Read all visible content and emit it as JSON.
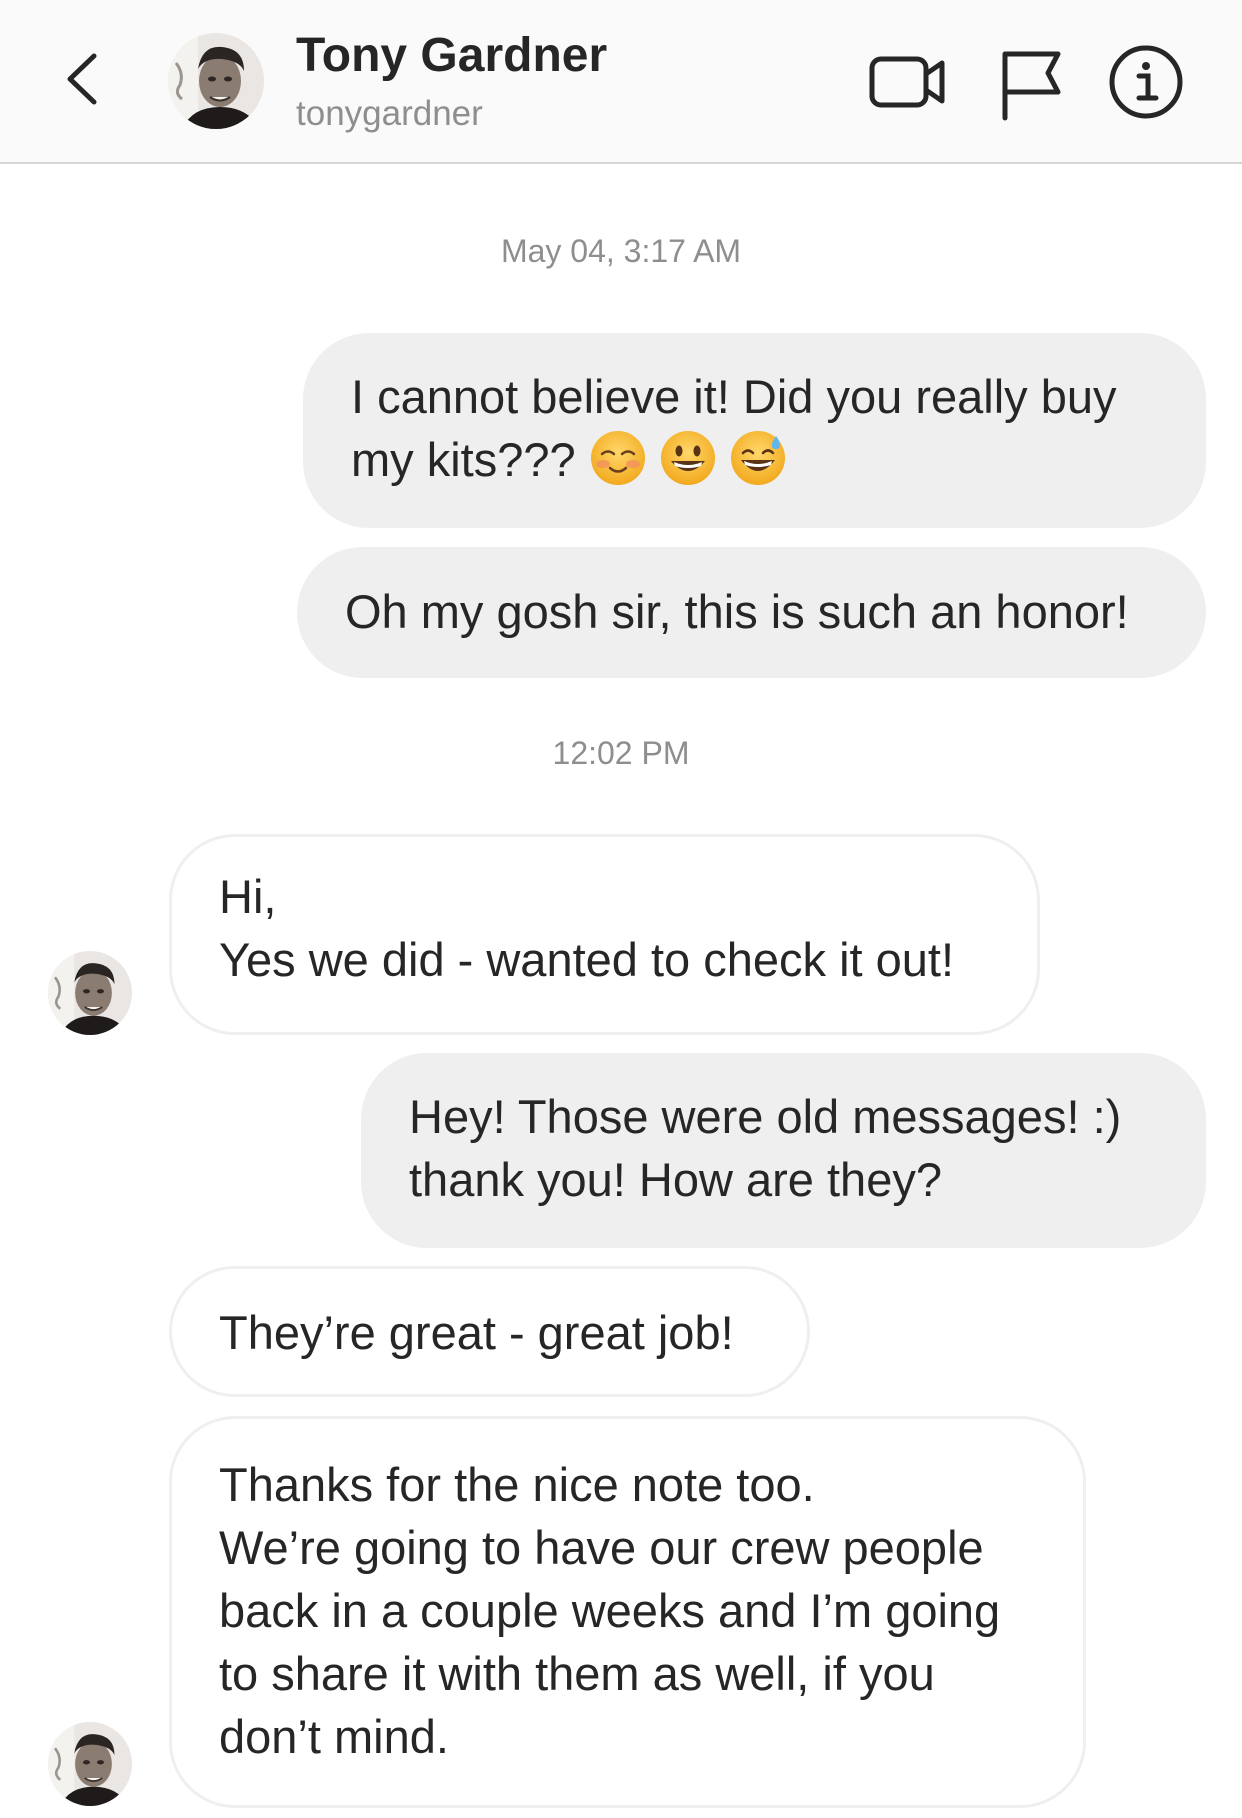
{
  "header": {
    "contact_name": "Tony Gardner",
    "contact_username": "tonygardner",
    "icons": [
      "back-chevron-icon",
      "avatar",
      "video-call-icon",
      "flag-icon",
      "info-icon"
    ]
  },
  "thread": {
    "timestamps": [
      "May 04, 3:17 AM",
      "12:02 PM"
    ],
    "messages": [
      {
        "from": "me",
        "text": "I cannot believe it! Did you really buy\nmy kits???",
        "emoji": [
          "smiling-blush-emoji",
          "grinning-face-emoji",
          "grinning-sweat-emoji"
        ]
      },
      {
        "from": "me",
        "text": "Oh my gosh sir, this is such an honor!"
      },
      {
        "from": "them",
        "text": "Hi,\nYes we did - wanted to check it out!"
      },
      {
        "from": "me",
        "text": "Hey! Those were old messages! :)\nthank you! How are they?"
      },
      {
        "from": "them",
        "text": "They’re great - great job!"
      },
      {
        "from": "them",
        "text": "Thanks for the nice note too.\nWe’re going to have our crew people\nback in a couple weeks and I’m going\nto share it with them as well, if you\ndon’t mind."
      }
    ]
  },
  "colors": {
    "header_bg": "#fafafa",
    "outgoing_bubble": "#efefef",
    "incoming_border": "#efefef",
    "text": "#262626",
    "secondary_text": "#8e8e8e"
  }
}
